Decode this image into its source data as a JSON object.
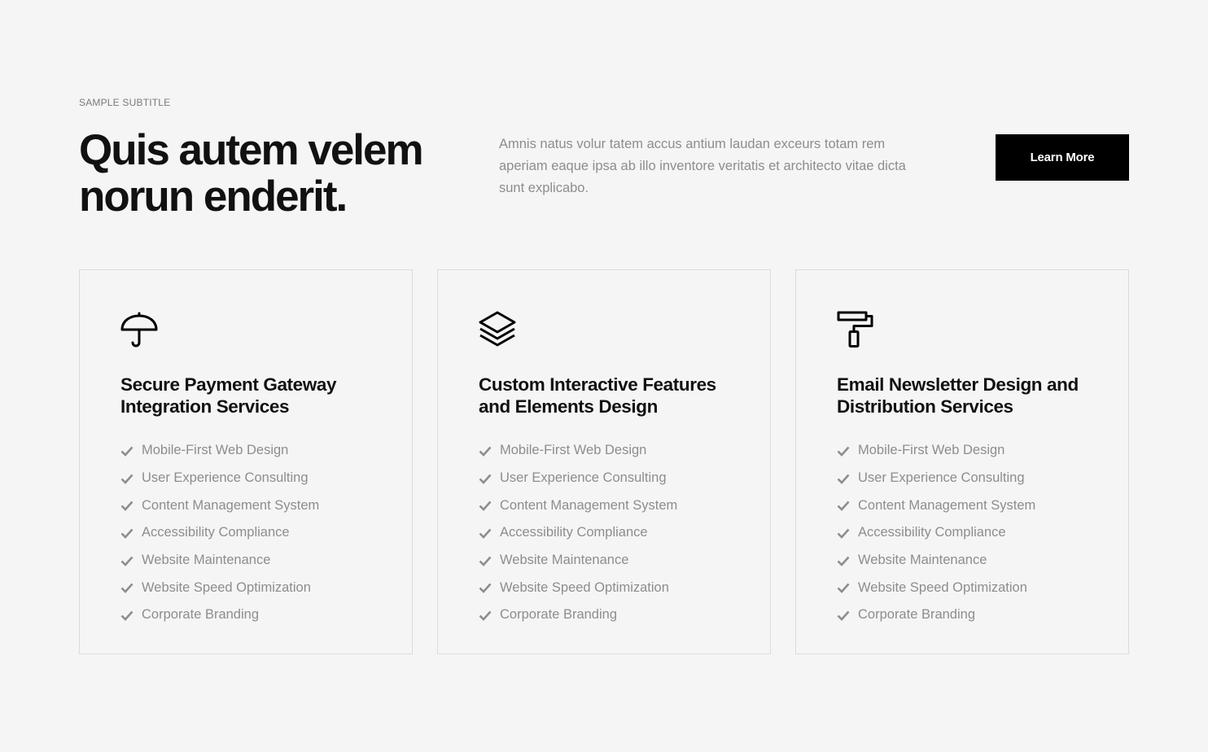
{
  "header": {
    "subtitle": "SAMPLE SUBTITLE",
    "title": "Quis autem velem norun enderit.",
    "intro": "Amnis natus volur tatem accus antium laudan exceurs totam rem aperiam eaque ipsa ab illo inventore veritatis et architecto vitae dicta sunt explicabo.",
    "cta_label": "Learn More"
  },
  "colors": {
    "background": "#f5f5f5",
    "button": "#000000",
    "muted_text": "#8d8d8d",
    "border": "#dcdcdc"
  },
  "cards": [
    {
      "icon": "umbrella-icon",
      "title": "Secure Payment Gateway Integration Services",
      "features": [
        "Mobile-First Web Design",
        "User Experience Consulting",
        "Content Management System",
        "Accessibility Compliance",
        "Website Maintenance",
        "Website Speed Optimization",
        "Corporate Branding"
      ]
    },
    {
      "icon": "layers-icon",
      "title": "Custom Interactive Features and Elements Design",
      "features": [
        "Mobile-First Web Design",
        "User Experience Consulting",
        "Content Management System",
        "Accessibility Compliance",
        "Website Maintenance",
        "Website Speed Optimization",
        "Corporate Branding"
      ]
    },
    {
      "icon": "paint-roller-icon",
      "title": "Email Newsletter Design and Distribution Services",
      "features": [
        "Mobile-First Web Design",
        "User Experience Consulting",
        "Content Management System",
        "Accessibility Compliance",
        "Website Maintenance",
        "Website Speed Optimization",
        "Corporate Branding"
      ]
    }
  ]
}
